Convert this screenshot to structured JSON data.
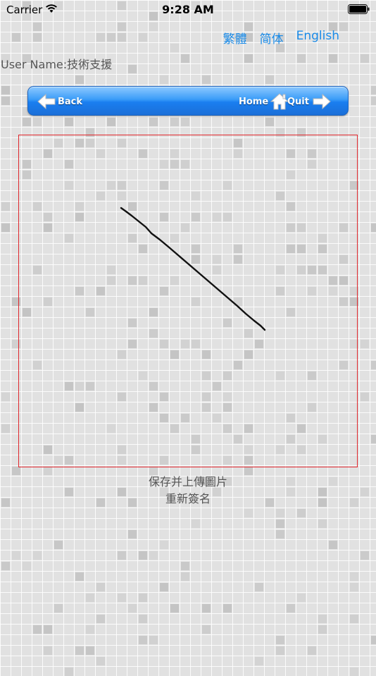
{
  "status_bar": {
    "carrier": "Carrier",
    "time": "9:28 AM"
  },
  "languages": [
    {
      "label": "繁體"
    },
    {
      "label": "简体"
    },
    {
      "label": "English"
    }
  ],
  "user": {
    "label": "User Name:技術支援"
  },
  "nav": {
    "back_label": "Back",
    "home_label": "Home",
    "quit_label": "Quit"
  },
  "actions": {
    "save_upload_label": "保存并上傳圖片",
    "resign_label": "重新簽名"
  },
  "colors": {
    "link_blue": "#1a8be8",
    "nav_blue": "#2a8cf4",
    "pad_border": "#e0262c"
  }
}
